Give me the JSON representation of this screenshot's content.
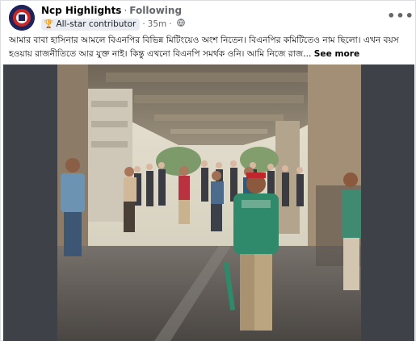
{
  "post": {
    "page_name": "Ncp Highlights",
    "follow_label": "Following",
    "badge_label": "All-star contributor",
    "timestamp": "35m",
    "privacy_icon": "globe-icon",
    "more_icon": "more-horizontal-icon",
    "text": "আমার বাবা হাসিনার আমলে বিএনপির বিভিন্ন মিটিংয়েও অংশ নিতেন। বিএনপির কমিটিতেও নাম ছিলো। এখন বয়স হওয়ায় রাজনীতিতে আর যুক্ত নাই। কিন্তু এখনো বিএনপি সমর্থক ওনি। আমি নিজে রাজ...",
    "see_more_label": "See more"
  },
  "colors": {
    "accent": "#1877f2",
    "secondary_text": "#65676b",
    "photo_backdrop": "#3e4147",
    "jersey_green": "#2f8a6b"
  }
}
